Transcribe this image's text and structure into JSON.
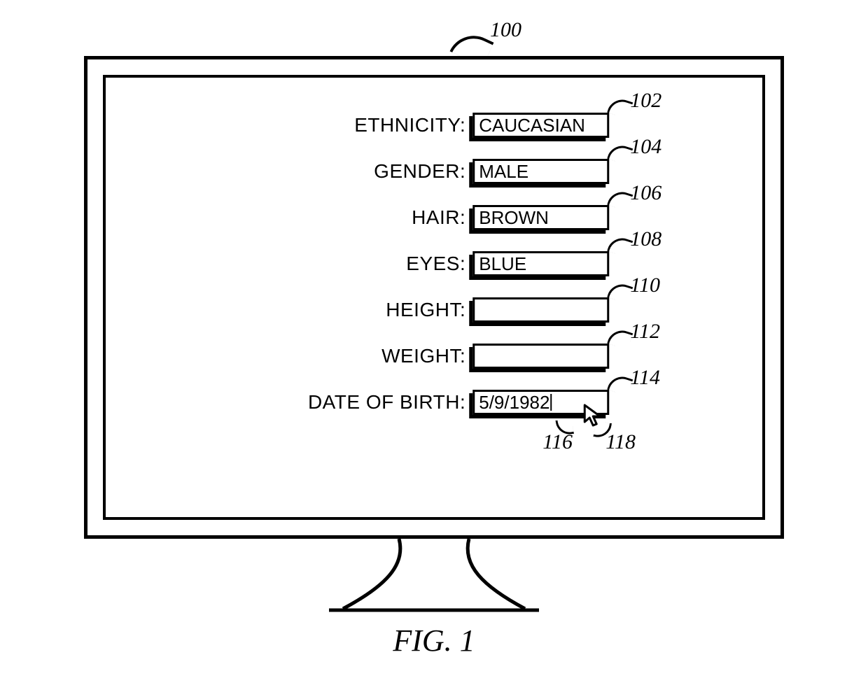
{
  "figure": {
    "caption": "FIG. 1",
    "monitor_ref": "100"
  },
  "form": {
    "rows": [
      {
        "label": "ETHNICITY:",
        "value": "CAUCASIAN",
        "ref": "102"
      },
      {
        "label": "GENDER:",
        "value": "MALE",
        "ref": "104"
      },
      {
        "label": "HAIR:",
        "value": "BROWN",
        "ref": "106"
      },
      {
        "label": "EYES:",
        "value": "BLUE",
        "ref": "108"
      },
      {
        "label": "HEIGHT:",
        "value": "",
        "ref": "110"
      },
      {
        "label": "WEIGHT:",
        "value": "",
        "ref": "112"
      },
      {
        "label": "DATE OF BIRTH:",
        "value": "5/9/1982",
        "ref": "114"
      }
    ],
    "caret_ref": "116",
    "cursor_ref": "118"
  }
}
